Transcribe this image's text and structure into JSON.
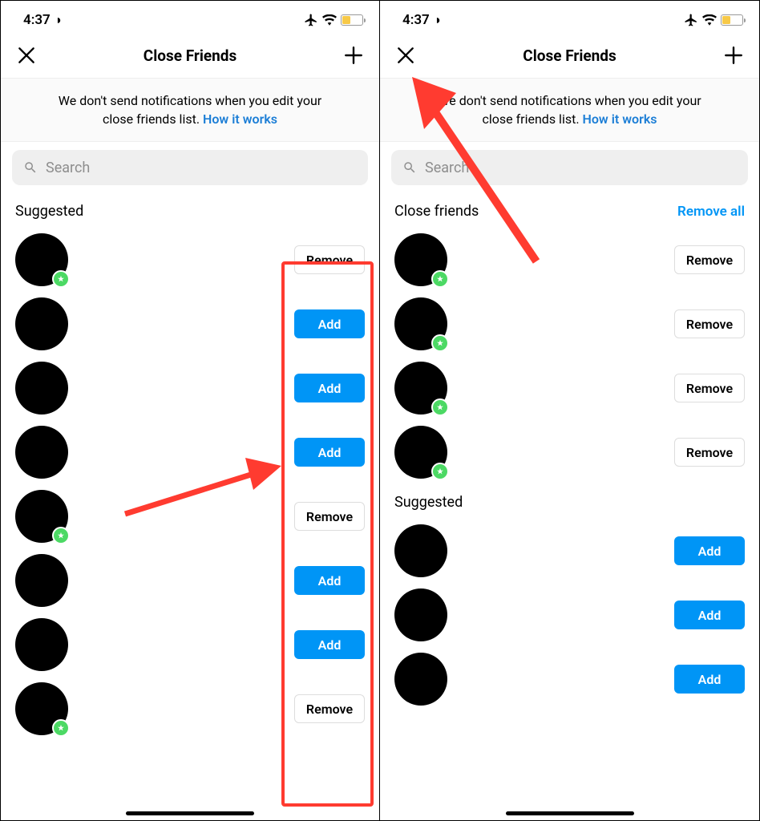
{
  "status": {
    "time": "4:37"
  },
  "nav": {
    "title": "Close Friends"
  },
  "notice": {
    "text_line1": "We don't send notifications when you edit your",
    "text_line2": "close friends list.",
    "link": "How it works"
  },
  "search": {
    "placeholder": "Search"
  },
  "left": {
    "section_title": "Suggested",
    "rows": [
      {
        "action": "remove",
        "label": "Remove",
        "star": true
      },
      {
        "action": "add",
        "label": "Add",
        "star": false
      },
      {
        "action": "add",
        "label": "Add",
        "star": false
      },
      {
        "action": "add",
        "label": "Add",
        "star": false
      },
      {
        "action": "remove",
        "label": "Remove",
        "star": true
      },
      {
        "action": "add",
        "label": "Add",
        "star": false
      },
      {
        "action": "add",
        "label": "Add",
        "star": false
      },
      {
        "action": "remove",
        "label": "Remove",
        "star": true
      }
    ]
  },
  "right": {
    "close_section": {
      "title": "Close friends",
      "remove_all": "Remove all",
      "rows": [
        {
          "label": "Remove",
          "star": true
        },
        {
          "label": "Remove",
          "star": true
        },
        {
          "label": "Remove",
          "star": true
        },
        {
          "label": "Remove",
          "star": true
        }
      ]
    },
    "suggested_section": {
      "title": "Suggested",
      "rows": [
        {
          "label": "Add"
        },
        {
          "label": "Add"
        },
        {
          "label": "Add"
        }
      ]
    }
  }
}
